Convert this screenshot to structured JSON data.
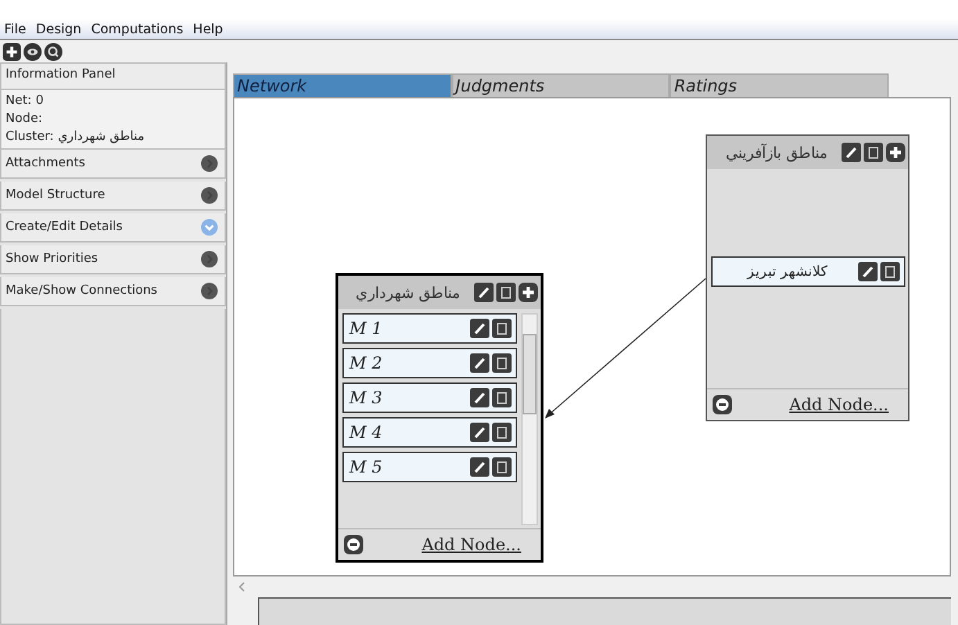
{
  "menu": [
    "File",
    "Design",
    "Computations",
    "Help"
  ],
  "info_panel": {
    "title": "Information Panel",
    "lines": [
      "Net: 0",
      "Node:",
      "Cluster: مناطق شهرداري"
    ]
  },
  "sections": [
    {
      "label": "Attachments",
      "expanded": false
    },
    {
      "label": "Model Structure",
      "expanded": false
    },
    {
      "label": "Create/Edit Details",
      "expanded": true
    },
    {
      "label": "Show Priorities",
      "expanded": false
    },
    {
      "label": "Make/Show Connections",
      "expanded": false
    }
  ],
  "tabs": [
    {
      "label": "Network",
      "selected": true
    },
    {
      "label": "Judgments",
      "selected": false
    },
    {
      "label": "Ratings",
      "selected": false
    }
  ],
  "clusters": [
    {
      "title": "مناطق شهرداري",
      "selected": true,
      "scrollable": true,
      "add_label": "Add Node...",
      "nodes": [
        {
          "label": "M 1",
          "kind": "latin"
        },
        {
          "label": "M 2",
          "kind": "latin"
        },
        {
          "label": "M 3",
          "kind": "latin"
        },
        {
          "label": "M 4",
          "kind": "latin"
        },
        {
          "label": "M 5",
          "kind": "latin"
        }
      ]
    },
    {
      "title": "مناطق بازآفريني",
      "selected": false,
      "scrollable": false,
      "add_label": "Add Node...",
      "nodes": [
        {
          "label": "كلانشهر تبريز",
          "kind": "arabic"
        }
      ]
    }
  ]
}
